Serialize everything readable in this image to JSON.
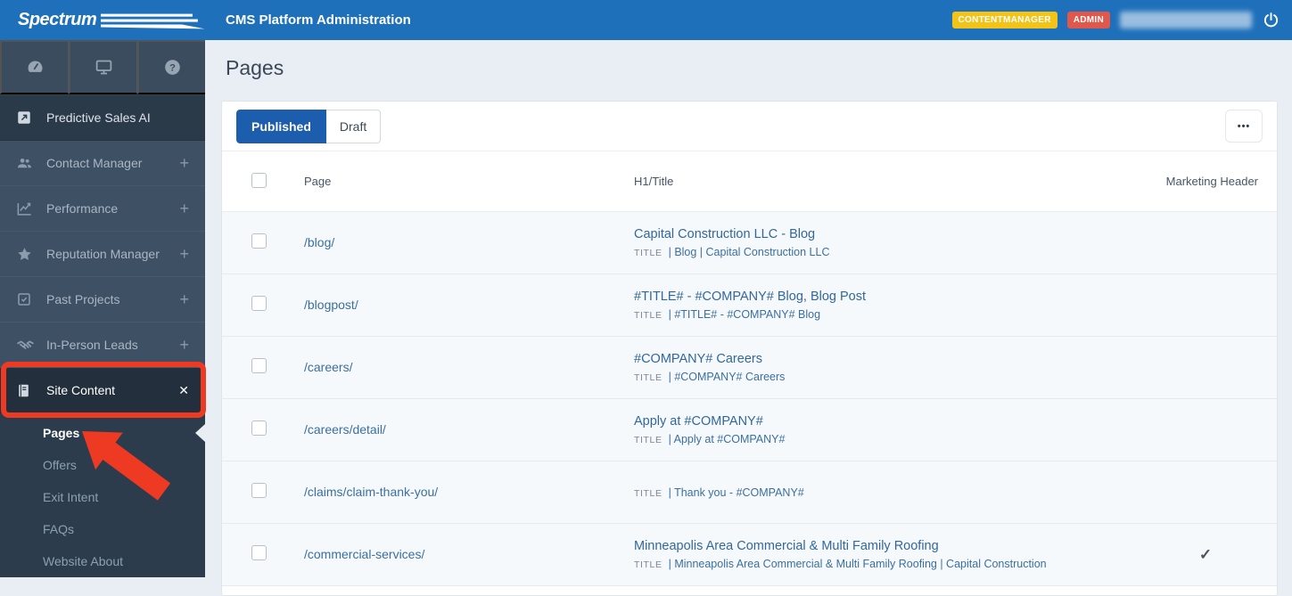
{
  "topbar": {
    "logo": "Spectrum",
    "title": "CMS Platform Administration",
    "badges": [
      {
        "label": "CONTENTMANAGER",
        "color": "#f3c417"
      },
      {
        "label": "ADMIN",
        "color": "#e2574c"
      }
    ],
    "user": "(redacted)",
    "power_icon": "power-icon"
  },
  "sidebar": {
    "top_icons": [
      {
        "icon": "gauge",
        "name": "dashboard-icon"
      },
      {
        "icon": "monitor",
        "name": "monitor-icon"
      },
      {
        "icon": "help",
        "name": "help-icon"
      }
    ],
    "items": [
      {
        "label": "Predictive Sales AI",
        "icon": "external",
        "style": "dark",
        "action": ""
      },
      {
        "label": "Contact Manager",
        "icon": "users",
        "action": "+"
      },
      {
        "label": "Performance",
        "icon": "chart",
        "action": "+"
      },
      {
        "label": "Reputation Manager",
        "icon": "star",
        "action": "+"
      },
      {
        "label": "Past Projects",
        "icon": "checksquare",
        "action": "+"
      },
      {
        "label": "In-Person Leads",
        "icon": "handshake",
        "action": "+"
      },
      {
        "label": "Site Content",
        "icon": "book",
        "style": "expanded",
        "action": "✕"
      }
    ],
    "subitems": [
      {
        "label": "Pages",
        "active": true
      },
      {
        "label": "Offers"
      },
      {
        "label": "Exit Intent"
      },
      {
        "label": "FAQs"
      },
      {
        "label": "Website About"
      }
    ]
  },
  "main": {
    "heading": "Pages",
    "toolbar": {
      "published": "Published",
      "draft": "Draft",
      "more": "•••"
    },
    "table": {
      "headers": [
        "Page",
        "H1/Title",
        "Marketing Header"
      ],
      "title_label": "TITLE",
      "rows": [
        {
          "page": "/blog/",
          "h1": "Capital Construction LLC - Blog",
          "title": "| Blog | Capital Construction LLC",
          "marketing": false
        },
        {
          "page": "/blogpost/",
          "h1": "#TITLE# - #COMPANY# Blog, Blog Post",
          "title": "| #TITLE# - #COMPANY# Blog",
          "marketing": false
        },
        {
          "page": "/careers/",
          "h1": "#COMPANY# Careers",
          "title": "| #COMPANY# Careers",
          "marketing": false
        },
        {
          "page": "/careers/detail/",
          "h1": "Apply at #COMPANY#",
          "title": "| Apply at #COMPANY#",
          "marketing": false
        },
        {
          "page": "/claims/claim-thank-you/",
          "h1": "",
          "title": "| Thank you - #COMPANY#",
          "marketing": false
        },
        {
          "page": "/commercial-services/",
          "h1": "Minneapolis Area Commercial & Multi Family Roofing",
          "title": "| Minneapolis Area Commercial & Multi Family Roofing | Capital Construction",
          "marketing": true
        }
      ]
    }
  },
  "annotation": {
    "color": "#ee3a23",
    "box_target": "Site Content",
    "arrow_target": "Pages"
  },
  "colors": {
    "topbar_blue": "#1f70ba",
    "sidebar_navy": "#3e5164",
    "active_button_blue": "#1d5dad",
    "link_blue": "#3a6f9f"
  }
}
